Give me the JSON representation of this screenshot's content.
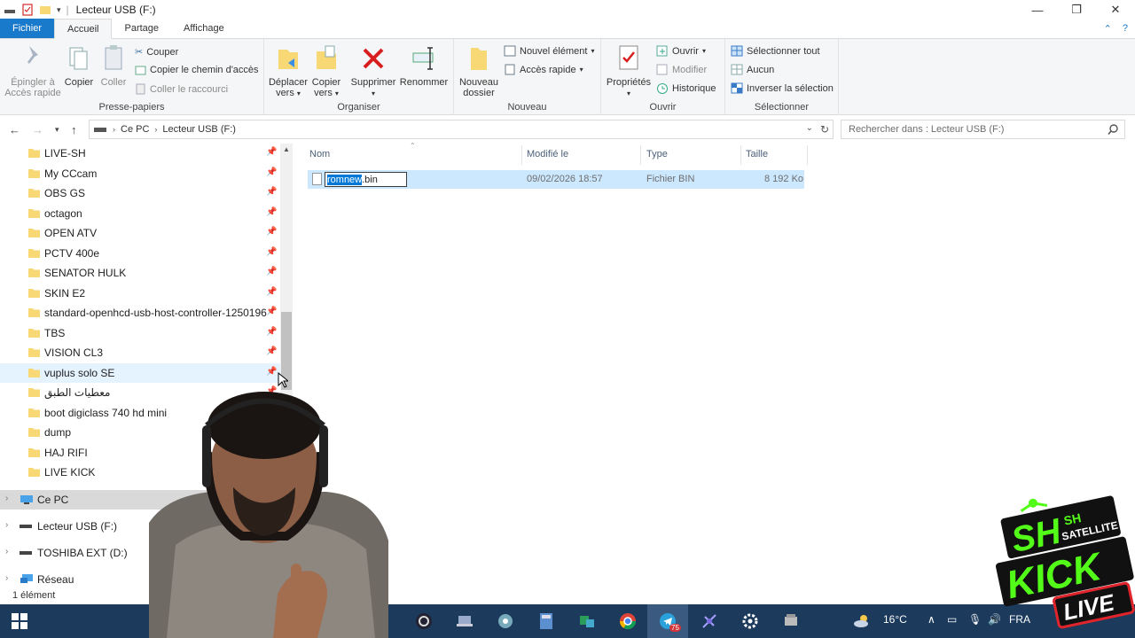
{
  "window": {
    "title": "Lecteur USB (F:)"
  },
  "tabs": [
    {
      "label": "Fichier"
    },
    {
      "label": "Accueil"
    },
    {
      "label": "Partage"
    },
    {
      "label": "Affichage"
    }
  ],
  "ribbon": {
    "clipboard": {
      "group_label": "Presse-papiers",
      "pin_label_1": "Épingler à",
      "pin_label_2": "Accès rapide",
      "copy": "Copier",
      "paste": "Coller",
      "cut": "Couper",
      "copy_path": "Copier le chemin d'accès",
      "paste_shortcut": "Coller le raccourci"
    },
    "organize": {
      "group_label": "Organiser",
      "move_1": "Déplacer",
      "move_2": "vers",
      "copyto_1": "Copier",
      "copyto_2": "vers",
      "delete": "Supprimer",
      "rename": "Renommer"
    },
    "new": {
      "group_label": "Nouveau",
      "new_folder_1": "Nouveau",
      "new_folder_2": "dossier",
      "new_item": "Nouvel élément",
      "easy_access": "Accès rapide"
    },
    "open": {
      "group_label": "Ouvrir",
      "properties": "Propriétés",
      "open": "Ouvrir",
      "edit": "Modifier",
      "history": "Historique"
    },
    "select": {
      "group_label": "Sélectionner",
      "select_all": "Sélectionner tout",
      "select_none": "Aucun",
      "invert": "Inverser la sélection"
    }
  },
  "address": {
    "crumbs": [
      "Ce PC",
      "Lecteur USB (F:)"
    ],
    "search_placeholder": "Rechercher dans : Lecteur USB (F:)"
  },
  "nav": {
    "quick_access": [
      "LIVE-SH",
      "My CCcam",
      "OBS GS",
      "octagon",
      "OPEN ATV",
      "PCTV 400e",
      "SENATOR HULK",
      "SKIN E2",
      "standard-openhcd-usb-host-controller-1250196",
      "TBS",
      "VISION CL3",
      "vuplus solo SE",
      "معطيات الطبق",
      "boot digiclass 740 hd mini",
      "dump",
      "HAJ RIFI",
      "LIVE KICK"
    ],
    "this_pc": "Ce PC",
    "usb": "Lecteur USB (F:)",
    "ext": "TOSHIBA EXT (D:)",
    "network": "Réseau"
  },
  "columns": {
    "name": "Nom",
    "modified": "Modifié le",
    "type": "Type",
    "size": "Taille"
  },
  "files": [
    {
      "name_sel": "romnew",
      "name_ext": ".bin",
      "modified": "09/02/2026 18:57",
      "type": "Fichier BIN",
      "size": "8 192 Ko"
    }
  ],
  "status": {
    "count": "1 élément"
  },
  "taskbar": {
    "temperature": "16°C",
    "language": "FRA",
    "live_badge": "75"
  },
  "overlay": {
    "brand_sh": "SH",
    "brand_satellite": "SATELLITE",
    "brand_kick": "KICK",
    "brand_live": "LIVE"
  },
  "colors": {
    "accent": "#1979ca",
    "selection": "#cce8ff",
    "folder": "#f8d775",
    "kick_green": "#53fc18"
  }
}
